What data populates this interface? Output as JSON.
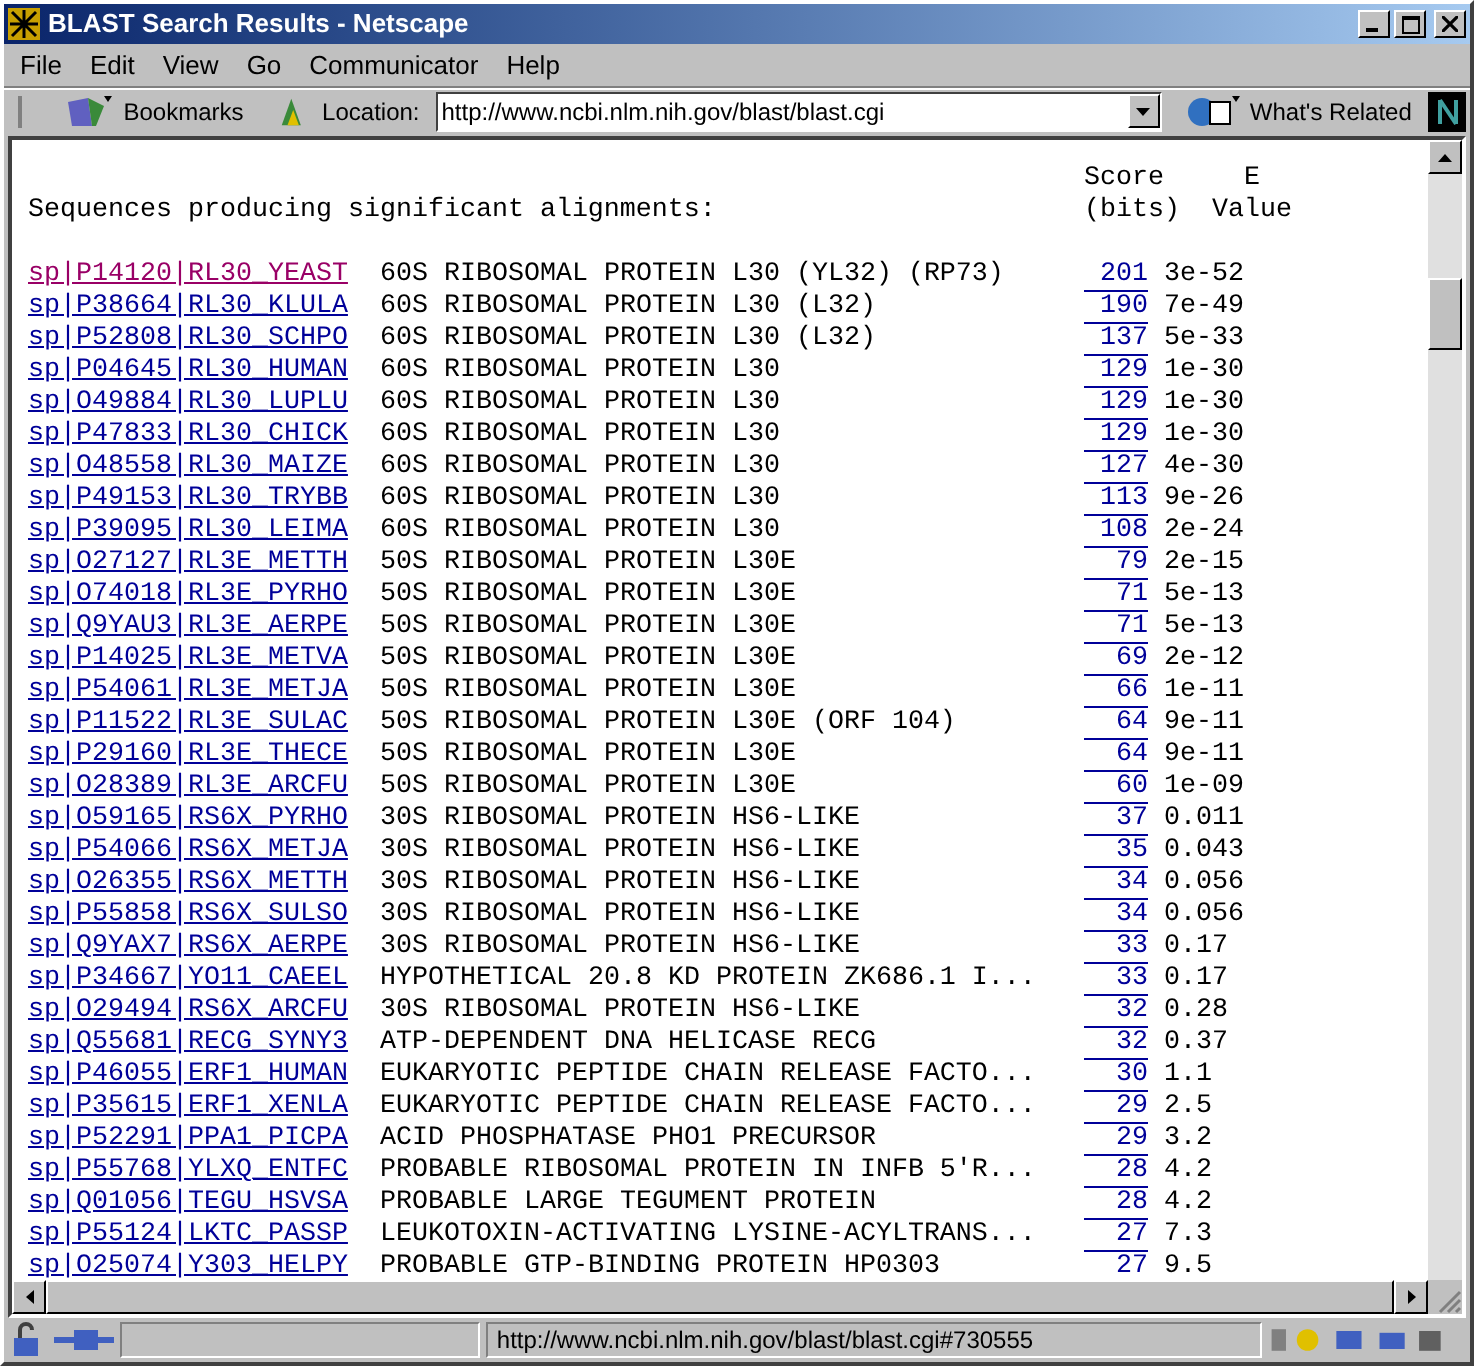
{
  "window": {
    "title": "BLAST Search Results - Netscape"
  },
  "menu": [
    "File",
    "Edit",
    "View",
    "Go",
    "Communicator",
    "Help"
  ],
  "toolbar": {
    "bookmarks": "Bookmarks",
    "location_label": "Location:",
    "url": "http://www.ncbi.nlm.nih.gov/blast/blast.cgi",
    "whats_related": "What's Related"
  },
  "results": {
    "heading": "Sequences producing significant alignments:",
    "score_header": [
      "Score",
      "(bits)"
    ],
    "evalue_header": [
      "E",
      "Value"
    ],
    "rows": [
      {
        "id": "sp|P14120|RL30_YEAST",
        "description": "60S RIBOSOMAL PROTEIN L30 (YL32) (RP73)",
        "score": "201",
        "evalue": "3e-52",
        "visited": true
      },
      {
        "id": "sp|P38664|RL30_KLULA",
        "description": "60S RIBOSOMAL PROTEIN L30 (L32)",
        "score": "190",
        "evalue": "7e-49",
        "visited": false
      },
      {
        "id": "sp|P52808|RL30_SCHPO",
        "description": "60S RIBOSOMAL PROTEIN L30 (L32)",
        "score": "137",
        "evalue": "5e-33",
        "visited": false
      },
      {
        "id": "sp|P04645|RL30_HUMAN",
        "description": "60S RIBOSOMAL PROTEIN L30",
        "score": "129",
        "evalue": "1e-30",
        "visited": false
      },
      {
        "id": "sp|O49884|RL30_LUPLU",
        "description": "60S RIBOSOMAL PROTEIN L30",
        "score": "129",
        "evalue": "1e-30",
        "visited": false
      },
      {
        "id": "sp|P47833|RL30_CHICK",
        "description": "60S RIBOSOMAL PROTEIN L30",
        "score": "129",
        "evalue": "1e-30",
        "visited": false
      },
      {
        "id": "sp|O48558|RL30_MAIZE",
        "description": "60S RIBOSOMAL PROTEIN L30",
        "score": "127",
        "evalue": "4e-30",
        "visited": false
      },
      {
        "id": "sp|P49153|RL30_TRYBB",
        "description": "60S RIBOSOMAL PROTEIN L30",
        "score": "113",
        "evalue": "9e-26",
        "visited": false
      },
      {
        "id": "sp|P39095|RL30_LEIMA",
        "description": "60S RIBOSOMAL PROTEIN L30",
        "score": "108",
        "evalue": "2e-24",
        "visited": false
      },
      {
        "id": "sp|O27127|RL3E_METTH",
        "description": "50S RIBOSOMAL PROTEIN L30E",
        "score": "79",
        "evalue": "2e-15",
        "visited": false
      },
      {
        "id": "sp|O74018|RL3E_PYRHO",
        "description": "50S RIBOSOMAL PROTEIN L30E",
        "score": "71",
        "evalue": "5e-13",
        "visited": false
      },
      {
        "id": "sp|Q9YAU3|RL3E_AERPE",
        "description": "50S RIBOSOMAL PROTEIN L30E",
        "score": "71",
        "evalue": "5e-13",
        "visited": false
      },
      {
        "id": "sp|P14025|RL3E_METVA",
        "description": "50S RIBOSOMAL PROTEIN L30E",
        "score": "69",
        "evalue": "2e-12",
        "visited": false
      },
      {
        "id": "sp|P54061|RL3E_METJA",
        "description": "50S RIBOSOMAL PROTEIN L30E",
        "score": "66",
        "evalue": "1e-11",
        "visited": false
      },
      {
        "id": "sp|P11522|RL3E_SULAC",
        "description": "50S RIBOSOMAL PROTEIN L30E (ORF 104)",
        "score": "64",
        "evalue": "9e-11",
        "visited": false
      },
      {
        "id": "sp|P29160|RL3E_THECE",
        "description": "50S RIBOSOMAL PROTEIN L30E",
        "score": "64",
        "evalue": "9e-11",
        "visited": false
      },
      {
        "id": "sp|O28389|RL3E_ARCFU",
        "description": "50S RIBOSOMAL PROTEIN L30E",
        "score": "60",
        "evalue": "1e-09",
        "visited": false
      },
      {
        "id": "sp|O59165|RS6X_PYRHO",
        "description": "30S RIBOSOMAL PROTEIN HS6-LIKE",
        "score": "37",
        "evalue": "0.011",
        "visited": false
      },
      {
        "id": "sp|P54066|RS6X_METJA",
        "description": "30S RIBOSOMAL PROTEIN HS6-LIKE",
        "score": "35",
        "evalue": "0.043",
        "visited": false
      },
      {
        "id": "sp|O26355|RS6X_METTH",
        "description": "30S RIBOSOMAL PROTEIN HS6-LIKE",
        "score": "34",
        "evalue": "0.056",
        "visited": false
      },
      {
        "id": "sp|P55858|RS6X_SULSO",
        "description": "30S RIBOSOMAL PROTEIN HS6-LIKE",
        "score": "34",
        "evalue": "0.056",
        "visited": false
      },
      {
        "id": "sp|Q9YAX7|RS6X_AERPE",
        "description": "30S RIBOSOMAL PROTEIN HS6-LIKE",
        "score": "33",
        "evalue": "0.17",
        "visited": false
      },
      {
        "id": "sp|P34667|YO11_CAEEL",
        "description": "HYPOTHETICAL 20.8 KD PROTEIN ZK686.1 I...",
        "score": "33",
        "evalue": "0.17",
        "visited": false
      },
      {
        "id": "sp|O29494|RS6X_ARCFU",
        "description": "30S RIBOSOMAL PROTEIN HS6-LIKE",
        "score": "32",
        "evalue": "0.28",
        "visited": false
      },
      {
        "id": "sp|Q55681|RECG_SYNY3",
        "description": "ATP-DEPENDENT DNA HELICASE RECG",
        "score": "32",
        "evalue": "0.37",
        "visited": false
      },
      {
        "id": "sp|P46055|ERF1_HUMAN",
        "description": "EUKARYOTIC PEPTIDE CHAIN RELEASE FACTO...",
        "score": "30",
        "evalue": "1.1",
        "visited": false
      },
      {
        "id": "sp|P35615|ERF1_XENLA",
        "description": "EUKARYOTIC PEPTIDE CHAIN RELEASE FACTO...",
        "score": "29",
        "evalue": "2.5",
        "visited": false
      },
      {
        "id": "sp|P52291|PPA1_PICPA",
        "description": "ACID PHOSPHATASE PHO1 PRECURSOR",
        "score": "29",
        "evalue": "3.2",
        "visited": false
      },
      {
        "id": "sp|P55768|YLXQ_ENTFC",
        "description": "PROBABLE RIBOSOMAL PROTEIN IN INFB 5'R...",
        "score": "28",
        "evalue": "4.2",
        "visited": false
      },
      {
        "id": "sp|Q01056|TEGU_HSVSA",
        "description": "PROBABLE LARGE TEGUMENT PROTEIN",
        "score": "28",
        "evalue": "4.2",
        "visited": false
      },
      {
        "id": "sp|P55124|LKTC_PASSP",
        "description": "LEUKOTOXIN-ACTIVATING LYSINE-ACYLTRANS...",
        "score": "27",
        "evalue": "7.3",
        "visited": false
      },
      {
        "id": "sp|O25074|Y303_HELPY",
        "description": "PROBABLE GTP-BINDING PROTEIN HP0303",
        "score": "27",
        "evalue": "9.5",
        "visited": false
      }
    ]
  },
  "status_bar": {
    "url": "http://www.ncbi.nlm.nih.gov/blast/blast.cgi#730555"
  }
}
